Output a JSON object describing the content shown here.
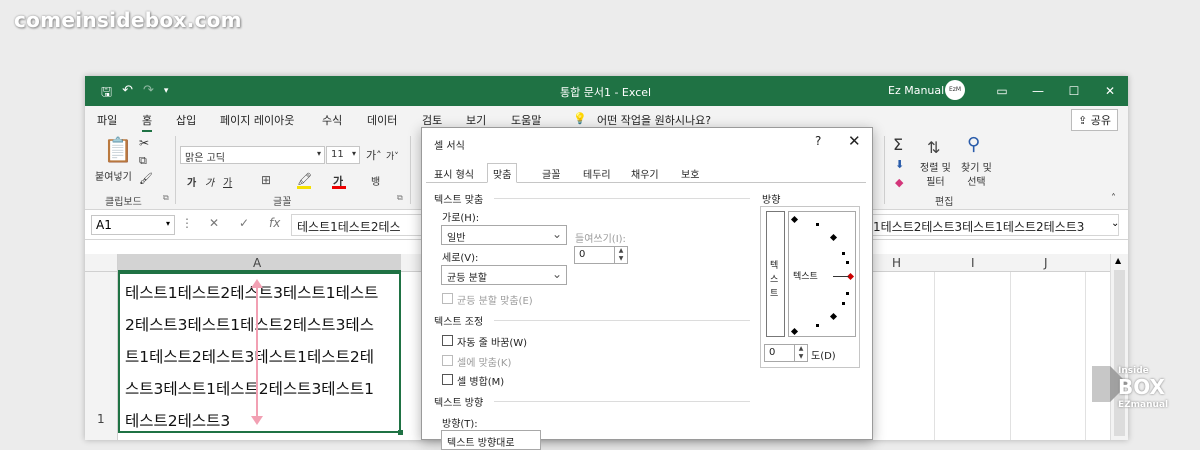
{
  "watermark": "comeinsidebox.com",
  "window": {
    "title": "통합 문서1  -  Excel",
    "user": "Ez Manual",
    "avatar_text": "EzM"
  },
  "menu": {
    "tabs": [
      "파일",
      "홈",
      "삽입",
      "페이지 레이아웃",
      "수식",
      "데이터",
      "검토",
      "보기",
      "도움말"
    ],
    "search": "어떤 작업을 원하시나요?",
    "share": "공유"
  },
  "ribbon": {
    "paste_label": "붙여넣기",
    "clipboard_label": "클립보드",
    "font_label": "글꼴",
    "font_name": "맑은 고딕",
    "font_size": "11",
    "editing_label": "편집",
    "sort_filter": "정렬 및\n필터",
    "find_select": "찾기 및\n선택"
  },
  "formula_bar": {
    "name_box": "A1",
    "fx": "fx",
    "content_left": "테스트1테스트2테스",
    "content_right": "1테스트2테스트3테스트1테스트2테스트3"
  },
  "sheet": {
    "columns": [
      "A",
      "H",
      "I",
      "J"
    ],
    "rows": [
      "1"
    ],
    "cell_a1_lines": [
      "테스트1테스트2테스트3테스트1테스트",
      "2테스트3테스트1테스트2테스트3테스",
      "트1테스트2테스트3테스트1테스트2테",
      "스트3테스트1테스트2테스트3테스트1",
      "테스트2테스트3"
    ]
  },
  "dialog": {
    "title": "셀 서식",
    "help": "?",
    "close": "✕",
    "tabs": [
      "표시 형식",
      "맞춤",
      "글꼴",
      "테두리",
      "채우기",
      "보호"
    ],
    "text_align_section": "텍스트 맞춤",
    "horizontal_label": "가로(H):",
    "horizontal_value": "일반",
    "indent_label": "들여쓰기(I):",
    "indent_value": "0",
    "vertical_label": "세로(V):",
    "vertical_value": "균등 분할",
    "justify_distributed": "균등 분할 맞춤(E)",
    "text_control_section": "텍스트 조정",
    "wrap_text": "자동 줄 바꿈(W)",
    "shrink_fit": "셀에 맞춤(K)",
    "merge_cells": "셀 병합(M)",
    "text_direction_section": "텍스트 방향",
    "direction_label": "방향(T):",
    "direction_value": "텍스트 방향대로",
    "orientation_label": "방향",
    "vertical_text": [
      "텍",
      "스",
      "트"
    ],
    "orientation_text": "텍스트",
    "degrees_value": "0",
    "degrees_label": "도(D)"
  },
  "logo": {
    "line1": "Inside",
    "line2": "BOX",
    "line3": "EZmanual"
  }
}
